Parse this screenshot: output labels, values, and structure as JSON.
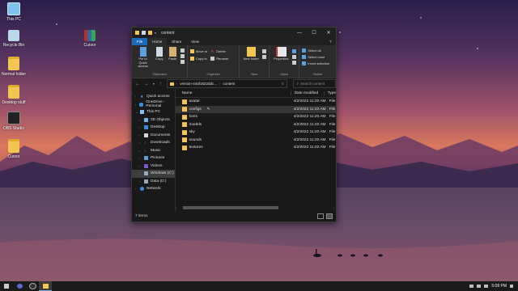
{
  "desktop": {
    "icons": [
      {
        "label": "This PC"
      },
      {
        "label": "Recycle Bin"
      },
      {
        "label": "Cursor"
      },
      {
        "label": "Normal folder"
      },
      {
        "label": "Desktop stuff"
      },
      {
        "label": "OBS Studio"
      },
      {
        "label": "Cursor"
      }
    ]
  },
  "window": {
    "title": "content",
    "caption": {
      "minimize": "—",
      "maximize": "☐",
      "close": "✕"
    },
    "tabs": [
      {
        "label": "File"
      },
      {
        "label": "Home"
      },
      {
        "label": "Share"
      },
      {
        "label": "View"
      }
    ],
    "help": "?",
    "ribbon": {
      "clipboard": {
        "label": "Clipboard",
        "pin": "Pin to Quick access",
        "copy": "Copy",
        "paste": "Paste"
      },
      "organize": {
        "label": "Organize",
        "move_to": "Move to",
        "copy_to": "Copy to",
        "delete": "Delete",
        "rename": "Rename"
      },
      "new": {
        "label": "New",
        "new_folder": "New folder"
      },
      "open": {
        "label": "Open",
        "properties": "Properties"
      },
      "select": {
        "label": "Select",
        "select_all": "Select all",
        "select_none": "Select none",
        "invert": "Invert selection"
      }
    },
    "address": {
      "path": [
        "version-44af1822ddc...",
        "content"
      ],
      "search_placeholder": "Search content"
    },
    "nav": [
      {
        "label": "Quick access"
      },
      {
        "label": "OneDrive - Personal"
      },
      {
        "label": "This PC"
      },
      {
        "label": "3D Objects"
      },
      {
        "label": "Desktop"
      },
      {
        "label": "Documents"
      },
      {
        "label": "Downloads"
      },
      {
        "label": "Music"
      },
      {
        "label": "Pictures"
      },
      {
        "label": "Videos"
      },
      {
        "label": "Windows (C:)"
      },
      {
        "label": "Data (D:)"
      },
      {
        "label": "Network"
      }
    ],
    "columns": {
      "name": "Name",
      "date": "Date modified",
      "type": "Type"
    },
    "files": [
      {
        "name": "avatar",
        "date": "4/2/2022 11:20 AM",
        "type": "File"
      },
      {
        "name": "configs",
        "date": "4/2/2022 11:20 AM",
        "type": "File"
      },
      {
        "name": "fonts",
        "date": "4/2/2022 11:20 AM",
        "type": "File"
      },
      {
        "name": "models",
        "date": "4/2/2022 11:20 AM",
        "type": "File"
      },
      {
        "name": "sky",
        "date": "4/2/2022 11:20 AM",
        "type": "File"
      },
      {
        "name": "sounds",
        "date": "4/2/2022 11:20 AM",
        "type": "File"
      },
      {
        "name": "textures",
        "date": "4/2/2022 11:20 AM",
        "type": "File"
      }
    ],
    "status": "7 items"
  },
  "taskbar": {
    "time": "5:08 PM"
  },
  "colors": {
    "accent": "#1b6bbd",
    "folder": "#f3c552"
  }
}
